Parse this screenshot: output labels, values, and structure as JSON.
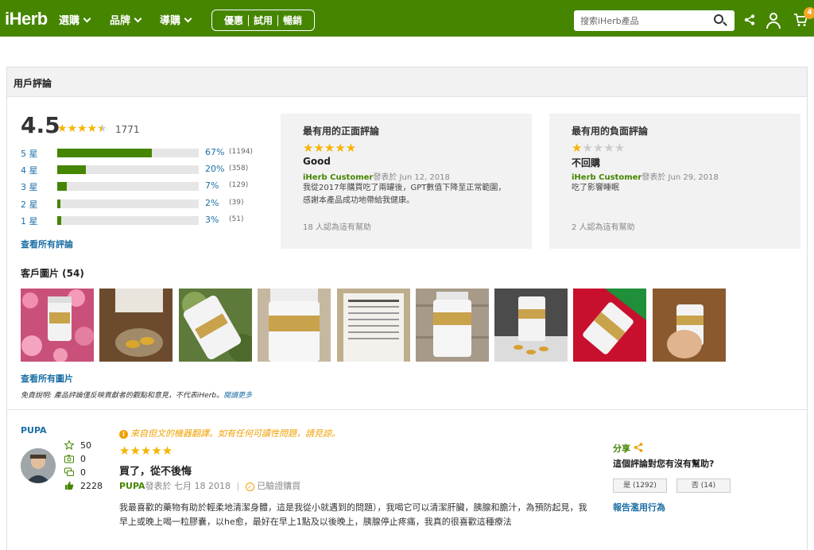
{
  "header": {
    "logo": "iHerb",
    "nav": [
      "選購",
      "品牌",
      "導購"
    ],
    "promos": [
      "優惠",
      "試用",
      "暢銷"
    ],
    "search_placeholder": "搜索iHerb產品",
    "cart_count": "4",
    "brand_color": "#458500"
  },
  "reviews_section": {
    "title": "用戶評論",
    "average": "4.5",
    "total_count": "1771",
    "distribution": [
      {
        "label": "5 星",
        "percent": "67%",
        "count": "(1194)",
        "fraction": 0.67
      },
      {
        "label": "4 星",
        "percent": "20%",
        "count": "(358)",
        "fraction": 0.2
      },
      {
        "label": "3 星",
        "percent": "7%",
        "count": "(129)",
        "fraction": 0.07
      },
      {
        "label": "2 星",
        "percent": "2%",
        "count": "(39)",
        "fraction": 0.02
      },
      {
        "label": "1 星",
        "percent": "3%",
        "count": "(51)",
        "fraction": 0.03
      }
    ],
    "see_all_reviews": "查看所有評論"
  },
  "top_positive": {
    "heading": "最有用的正面評論",
    "rating": 5,
    "title": "Good",
    "author": "iHerb Customer",
    "posted": "發表於 Jun 12, 2018",
    "body": "我從2017年購買吃了兩罐後，GPT數值下降至正常範圍，感謝本產品成功地帶給我健康。",
    "helpful": "18 人認為這有幫助"
  },
  "top_negative": {
    "heading": "最有用的負面評論",
    "rating": 1,
    "title": "不回購",
    "author": "iHerb Customer",
    "posted": "發表於 Jun 29, 2018",
    "body": "吃了影響睡眠",
    "helpful": "2 人認為這有幫助"
  },
  "customer_images": {
    "title": "客戶圖片 (54)",
    "see_all": "查看所有圖片",
    "disclaimer": "免責說明: 產品評論僅反映貢獻者的觀點和意見，不代表iHerb。",
    "disclaimer_link": "閱讀更多"
  },
  "review": {
    "reviewer": "PUPA",
    "stats": [
      "50",
      "0",
      "0",
      "2228"
    ],
    "translate_note": "來自但文的機器翻譯。如有任何可讀性問題，請見諒。",
    "rating": 5,
    "title": "買了，從不後悔",
    "author": "PUPA",
    "posted": "發表於 七月 18 2018",
    "verified": "已驗證購買",
    "body": "我最喜歡的藥物有助於輕柔地清潔身體，這是我從小就遇到的問題），我喝它可以清潔肝臟，胰腺和膽汁，為預防起見，我早上或晚上喝一粒膠囊，以he愈，最好在早上1點及以後晚上，胰腺停止疼痛，我真的很喜歡這種療法",
    "share": "分享",
    "helpful_q": "這個評論對您有沒有幫助?",
    "yes_btn": "是 (1292)",
    "no_btn": "否 (14)",
    "report": "報告濫用行為"
  }
}
